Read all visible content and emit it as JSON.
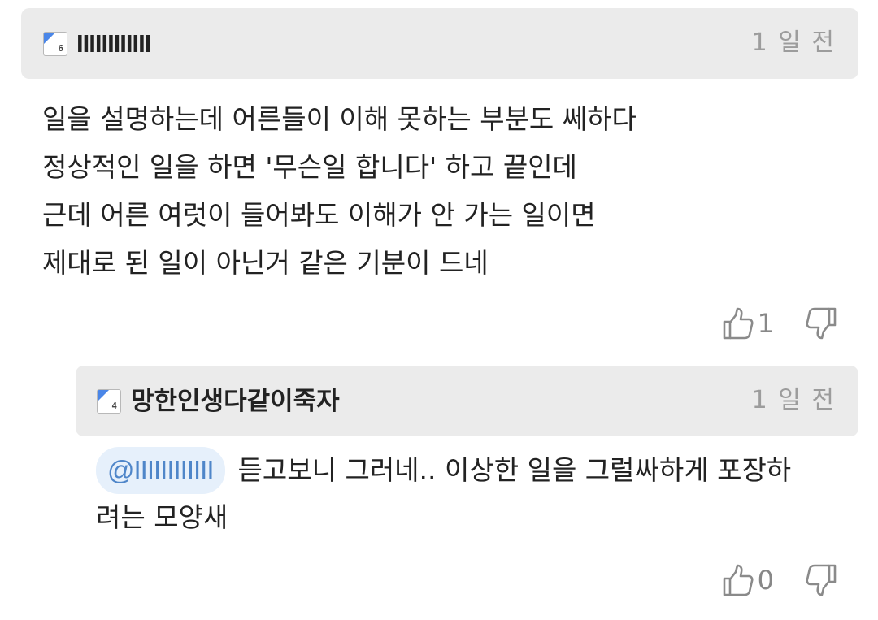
{
  "comment": {
    "level_badge": "6",
    "username": "IIIIIIIIIIII",
    "timestamp": "1 일 전",
    "lines": [
      "일을 설명하는데 어른들이 이해 못하는 부분도 쎄하다",
      "정상적인 일을 하면 '무슨일 합니다' 하고 끝인데",
      "근데 어른 여럿이 들어봐도 이해가 안 가는 일이면",
      "제대로 된 일이 아닌거 같은 기분이 드네"
    ],
    "likes": "1",
    "icons": {
      "like": "thumbs-up-icon",
      "dislike": "thumbs-down-icon"
    }
  },
  "reply": {
    "level_badge": "4",
    "username": "망한인생다같이죽자",
    "timestamp": "1 일 전",
    "mention": "@IIIIIIIIIIII",
    "line1": "듣고보니 그러네.. 이상한 일을 그럴싸하게 포장하",
    "line2": "려는 모양새",
    "likes": "0"
  },
  "colors": {
    "header_bg": "#ebebeb",
    "badge_accent": "#4a86e8",
    "mention_bg": "#e6f0fb",
    "mention_text": "#4f86c9",
    "muted": "#9c9c9c"
  }
}
